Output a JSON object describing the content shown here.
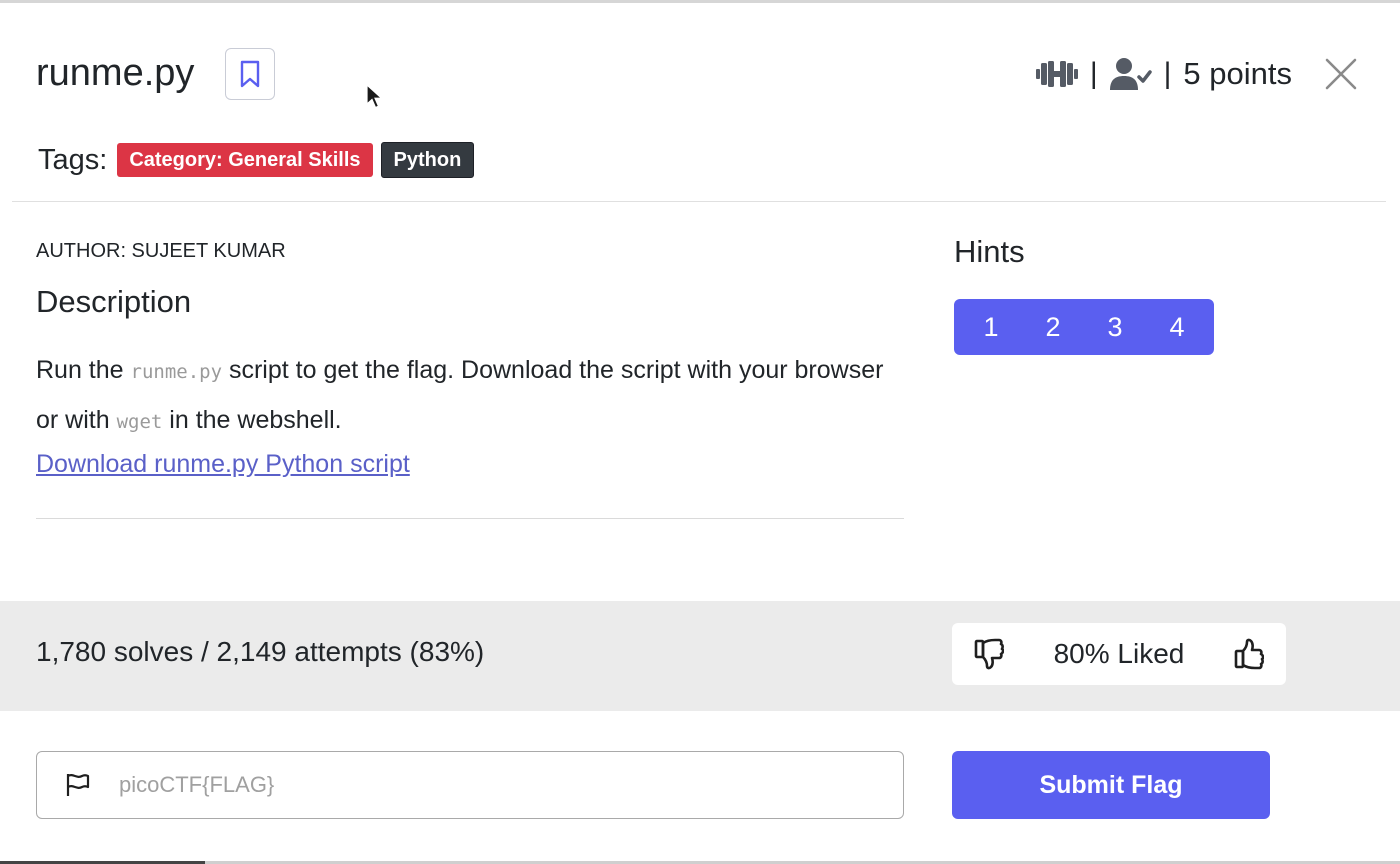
{
  "challenge": {
    "title": "runme.py",
    "points": "5 points",
    "separator": "|"
  },
  "tags": {
    "label": "Tags:",
    "items": [
      "Category: General Skills",
      "Python"
    ]
  },
  "author": "AUTHOR: SUJEET KUMAR",
  "description": {
    "heading": "Description",
    "text_1": "Run the ",
    "code_1": "runme.py",
    "text_2": " script to get the flag. Download the script with your browser or with ",
    "code_2": "wget",
    "text_3": " in the webshell.",
    "link": "Download runme.py Python script"
  },
  "hints": {
    "heading": "Hints",
    "buttons": [
      "1",
      "2",
      "3",
      "4"
    ]
  },
  "stats": {
    "solves": "1,780 solves / 2,149 attempts (83%)",
    "liked": "80% Liked"
  },
  "flag_form": {
    "placeholder": "picoCTF{FLAG}",
    "submit": "Submit Flag"
  },
  "icons": [
    "bookmark-icon",
    "dumbbell-icon",
    "user-check-icon",
    "close-icon",
    "thumbs-down-icon",
    "thumbs-up-icon",
    "flag-icon",
    "mouse-cursor-icon"
  ],
  "colors": {
    "accent": "#5a5ff0",
    "category_tag": "#dc3545",
    "python_tag": "#343a40",
    "stats_band": "#ebebeb"
  }
}
